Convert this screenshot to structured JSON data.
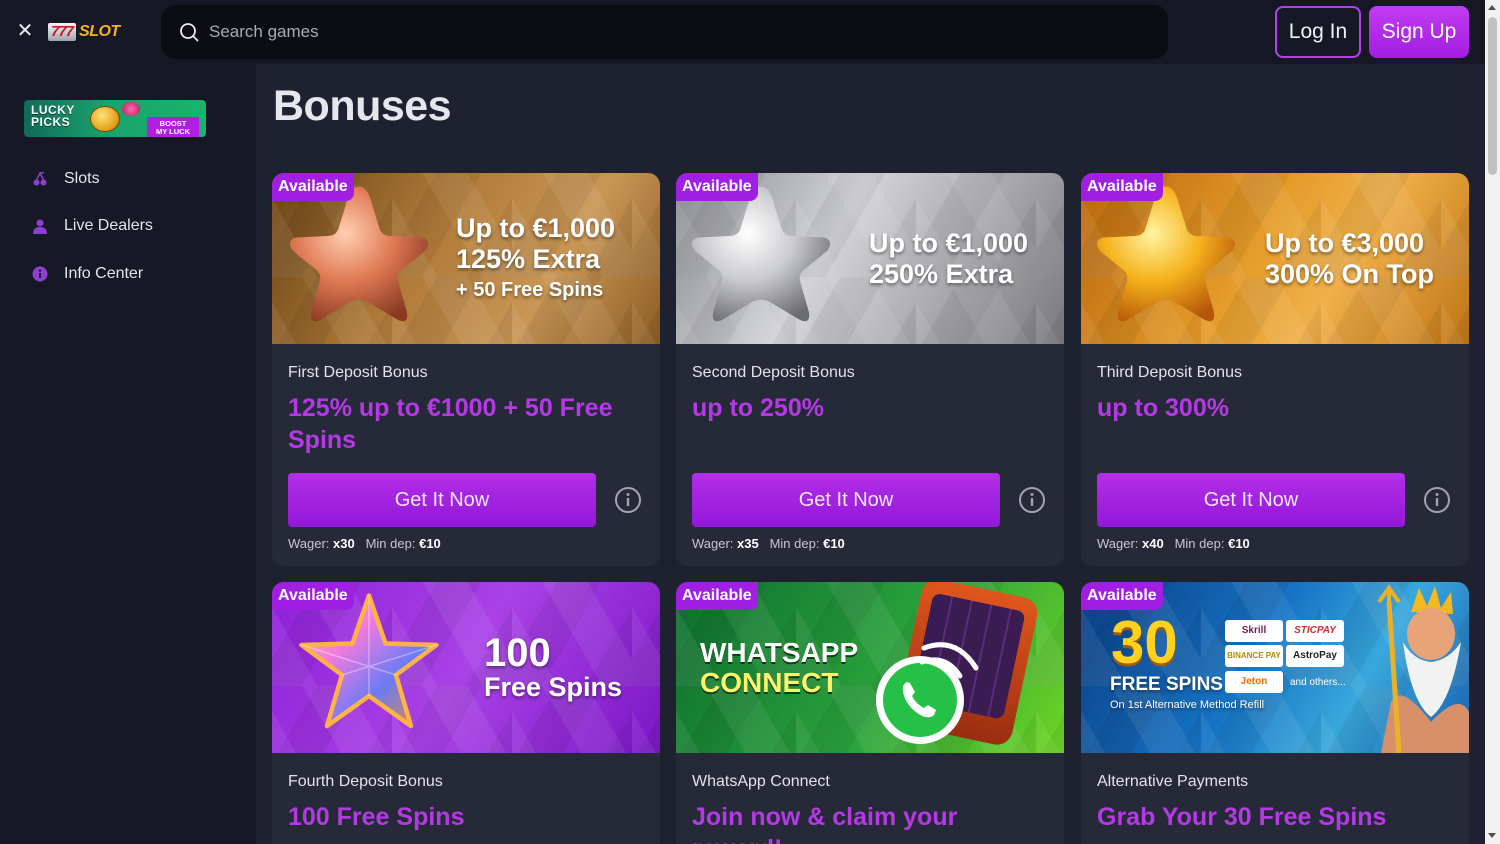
{
  "header": {
    "logo_sevens": "777",
    "logo_text": "SLOT",
    "search_placeholder": "Search games",
    "login_label": "Log In",
    "signup_label": "Sign Up"
  },
  "sidebar": {
    "promo_line1": "LUCKY",
    "promo_line2": "PICKS",
    "promo_badge1": "BOOST",
    "promo_badge2": "MY LUCK",
    "items": [
      {
        "label": "Slots",
        "icon": "cherries-icon"
      },
      {
        "label": "Live Dealers",
        "icon": "dealer-icon"
      },
      {
        "label": "Info Center",
        "icon": "info-icon"
      }
    ]
  },
  "main": {
    "title": "Bonuses",
    "cards": [
      {
        "badge": "Available",
        "img_l1": "Up to €1,000",
        "img_l2": "125% Extra",
        "img_l3": "+ 50 Free Spins",
        "subtitle": "First Deposit Bonus",
        "headline": "125% up to €1000 + 50 Free Spins",
        "cta": "Get It Now",
        "wager_label": "Wager:",
        "wager": "x30",
        "mindep_label": "Min dep:",
        "mindep": "€10"
      },
      {
        "badge": "Available",
        "img_l1": "Up to €1,000",
        "img_l2": "250% Extra",
        "subtitle": "Second Deposit Bonus",
        "headline": "up to 250%",
        "cta": "Get It Now",
        "wager_label": "Wager:",
        "wager": "x35",
        "mindep_label": "Min dep:",
        "mindep": "€10"
      },
      {
        "badge": "Available",
        "img_l1": "Up to €3,000",
        "img_l2": "300% On Top",
        "subtitle": "Third Deposit Bonus",
        "headline": "up to 300%",
        "cta": "Get It Now",
        "wager_label": "Wager:",
        "wager": "x40",
        "mindep_label": "Min dep:",
        "mindep": "€10"
      },
      {
        "badge": "Available",
        "img_l1": "100",
        "img_l2": "Free Spins",
        "subtitle": "Fourth Deposit Bonus",
        "headline": "100 Free Spins"
      },
      {
        "badge": "Available",
        "img_l1": "WHATSAPP",
        "img_l2": "CONNECT",
        "subtitle": "WhatsApp Connect",
        "headline": "Join now & claim your reward!"
      },
      {
        "badge": "Available",
        "img_l1": "30",
        "img_l2": "FREE SPINS",
        "img_l3": "On 1st Alternative Method Refill",
        "pay_methods": [
          "Skrill",
          "STICPAY",
          "BINANCE PAY",
          "AstroPay",
          "Jeton",
          "and others..."
        ],
        "subtitle": "Alternative Payments",
        "headline": "Grab Your 30 Free Spins"
      }
    ]
  },
  "colors": {
    "accent": "#b53ae6",
    "button": "#a11fe3",
    "bg": "#161925",
    "card": "#262a38"
  }
}
